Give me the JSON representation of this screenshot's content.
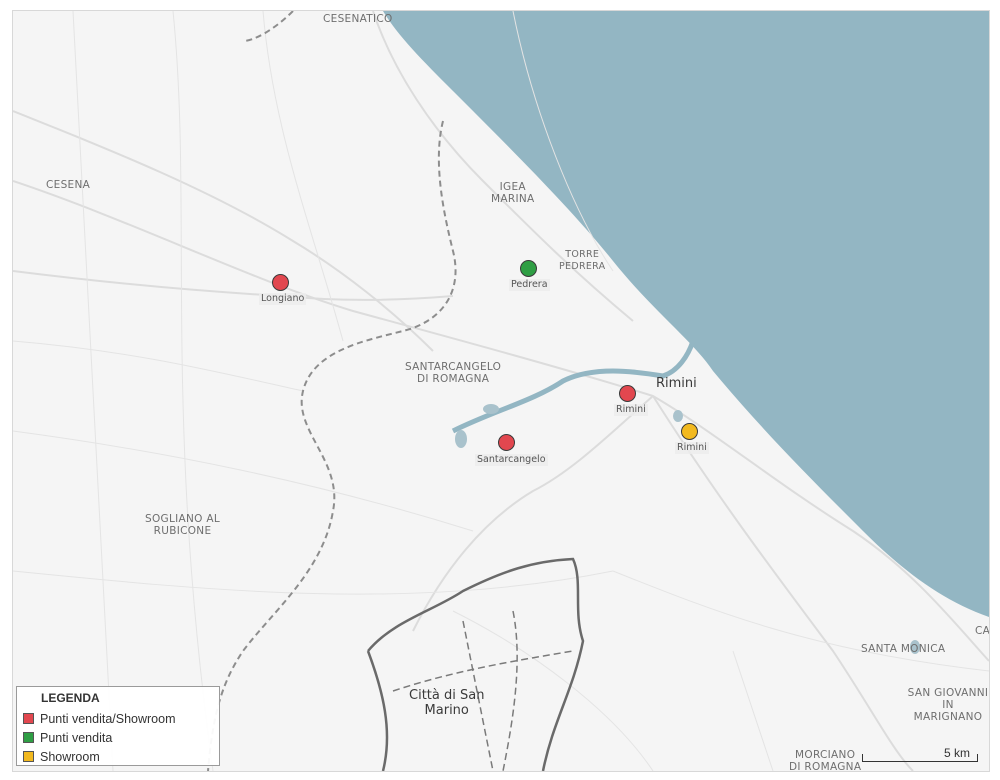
{
  "colors": {
    "sea": "#93b6c3",
    "land": "#f5f5f5",
    "punti_vendita_showroom": "#e2474f",
    "punti_vendita": "#2f9e44",
    "showroom": "#f2b91f"
  },
  "place_labels": {
    "cesenatico": "CESENATICO",
    "cesena": "CESENA",
    "igea_marina": "IGEA\nMARINA",
    "torre_pedrera": "TORRE\nPEDRERA",
    "rimini_city": "Rimini",
    "santarcangelo_di_romagna": "SANTARCANGELO\nDI ROMAGNA",
    "sogliano": "SOGLIANO AL\nRUBICONE",
    "san_marino": "Città di San\nMarino",
    "santa_monica": "SANTA MONICA",
    "san_giovanni": "SAN GIOVANNI\nIN MARIGNANO",
    "morciano": "MORCIANO\nDI ROMAGNA",
    "cattolica_partial": "CA"
  },
  "markers": [
    {
      "label": "Longiano",
      "category": "punti_vendita_showroom"
    },
    {
      "label": "Pedrera",
      "category": "punti_vendita"
    },
    {
      "label": "Rimini",
      "category": "punti_vendita_showroom"
    },
    {
      "label": "Santarcangelo",
      "category": "punti_vendita_showroom"
    },
    {
      "label": "Rimini",
      "category": "showroom"
    }
  ],
  "legend": {
    "title": "LEGENDA",
    "items": [
      {
        "label": "Punti vendita/Showroom",
        "color": "#e2474f"
      },
      {
        "label": "Punti vendita",
        "color": "#2f9e44"
      },
      {
        "label": "Showroom",
        "color": "#f2b91f"
      }
    ]
  },
  "scale": {
    "label": "5 km"
  }
}
